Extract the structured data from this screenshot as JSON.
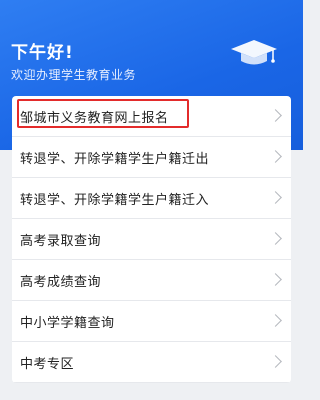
{
  "header": {
    "greeting": "下午好!",
    "subtitle": "欢迎办理学生教育业务",
    "icon": "graduation-cap-icon"
  },
  "menu": {
    "items": [
      {
        "label": "邹城市义务教育网上报名",
        "highlighted": true
      },
      {
        "label": "转退学、开除学籍学生户籍迁出"
      },
      {
        "label": "转退学、开除学籍学生户籍迁入"
      },
      {
        "label": "高考录取查询"
      },
      {
        "label": "高考成绩查询"
      },
      {
        "label": "中小学学籍查询"
      },
      {
        "label": "中考专区"
      }
    ]
  },
  "colors": {
    "header_blue": "#1a66e6",
    "highlight_red": "#e32b2b"
  }
}
